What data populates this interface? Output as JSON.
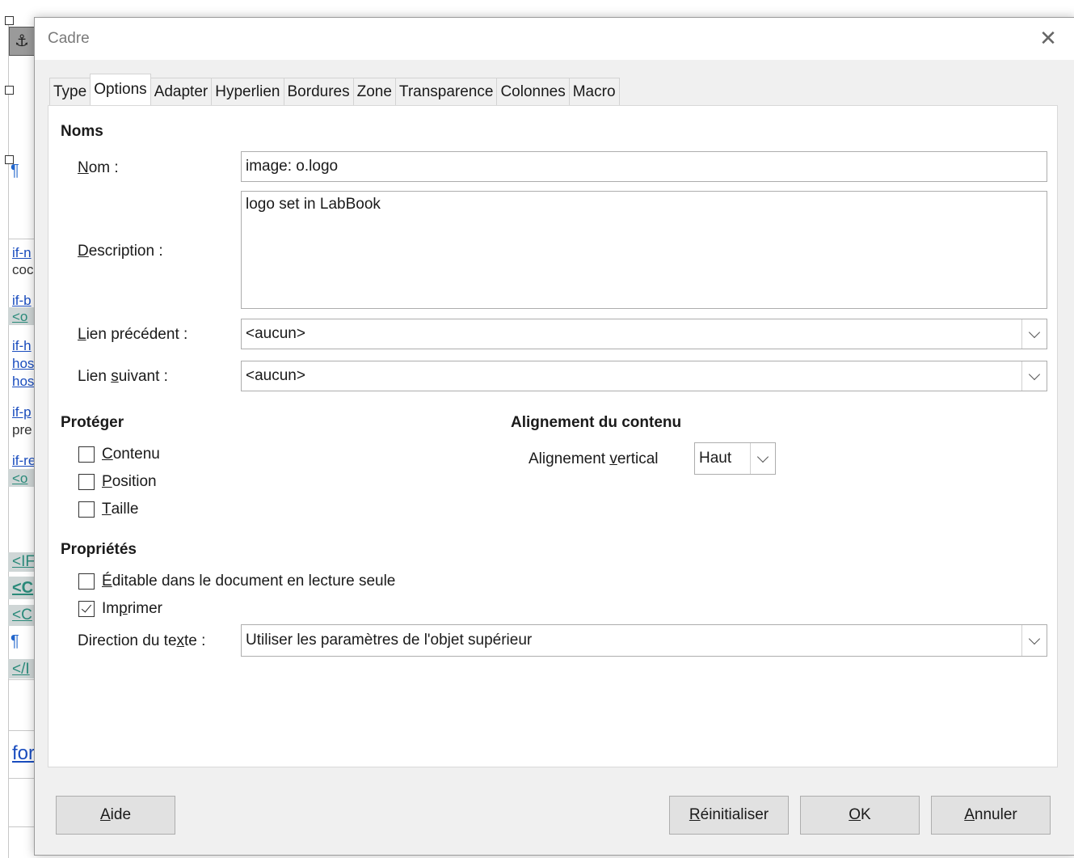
{
  "dialog": {
    "title": "Cadre",
    "close_glyph": "✕"
  },
  "tabs": [
    {
      "label": "Type"
    },
    {
      "label": "Options"
    },
    {
      "label": "Adapter"
    },
    {
      "label": "Hyperlien"
    },
    {
      "label": "Bordures"
    },
    {
      "label": "Zone"
    },
    {
      "label": "Transparence"
    },
    {
      "label": "Colonnes"
    },
    {
      "label": "Macro"
    }
  ],
  "active_tab": "Options",
  "noms": {
    "section": "Noms",
    "name_label_prefix": "N",
    "name_label_rest": "om :",
    "name_value": "image: o.logo",
    "description_label_prefix": "D",
    "description_label_rest": "escription :",
    "description_value": "logo set in LabBook",
    "prev_link_label_prefix": "L",
    "prev_link_label_rest": "ien précédent :",
    "prev_link_value": "<aucun>",
    "next_link_label_a": "Lien ",
    "next_link_label_u": "s",
    "next_link_label_b": "uivant :",
    "next_link_value": "<aucun>"
  },
  "proteger": {
    "section": "Protéger",
    "items": [
      {
        "u": "C",
        "rest": "ontenu",
        "checked": false
      },
      {
        "u": "P",
        "rest": "osition",
        "checked": false
      },
      {
        "u": "T",
        "rest": "aille",
        "checked": false
      }
    ]
  },
  "alignement": {
    "section": "Alignement du contenu",
    "vertical_label_a": "Alignement ",
    "vertical_label_u": "v",
    "vertical_label_b": "ertical",
    "vertical_value": "Haut"
  },
  "proprietes": {
    "section": "Propriétés",
    "editable_u": "É",
    "editable_rest": "ditable dans le document en lecture seule",
    "editable_checked": false,
    "print_a": "Im",
    "print_u": "p",
    "print_b": "rimer",
    "print_checked": true,
    "text_direction_label_a": "Direction du te",
    "text_direction_label_u": "x",
    "text_direction_label_b": "te :",
    "text_direction_value": "Utiliser les paramètres de l'objet supérieur"
  },
  "buttons": {
    "help_u": "A",
    "help_rest": "ide",
    "reset_u": "R",
    "reset_rest": "éinitialiser",
    "ok_u": "O",
    "ok_rest": "K",
    "cancel_u": "A",
    "cancel_rest": "nnuler"
  },
  "background": {
    "anchor_glyph": "⚓",
    "pilcrow": "¶",
    "lines": [
      "if-n",
      "coc",
      "if-b",
      "<o",
      "if-h",
      "hos",
      "hos",
      "if-p",
      "pre",
      "if-re",
      "<o",
      "<IF",
      "<C",
      "<C",
      "</I",
      "for"
    ]
  }
}
